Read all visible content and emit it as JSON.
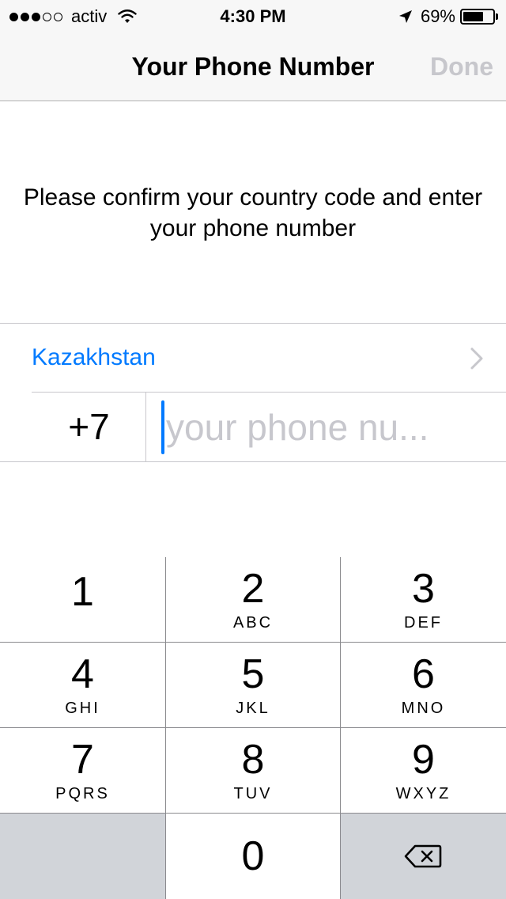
{
  "status_bar": {
    "carrier": "activ",
    "time": "4:30 PM",
    "battery_percent": "69%",
    "battery_level": 0.69,
    "signal_dots": [
      true,
      true,
      true,
      false,
      false
    ],
    "wifi_icon": "wifi-icon",
    "location_icon": "location-arrow-icon"
  },
  "nav": {
    "title": "Your Phone Number",
    "done_label": "Done"
  },
  "instruction": "Please confirm your country code and enter your phone number",
  "country": {
    "name": "Kazakhstan",
    "chevron_icon": "chevron-right-icon"
  },
  "phone": {
    "code": "+7",
    "placeholder": "your phone nu...",
    "value": ""
  },
  "keypad": {
    "keys": [
      {
        "num": "1",
        "letters": ""
      },
      {
        "num": "2",
        "letters": "ABC"
      },
      {
        "num": "3",
        "letters": "DEF"
      },
      {
        "num": "4",
        "letters": "GHI"
      },
      {
        "num": "5",
        "letters": "JKL"
      },
      {
        "num": "6",
        "letters": "MNO"
      },
      {
        "num": "7",
        "letters": "PQRS"
      },
      {
        "num": "8",
        "letters": "TUV"
      },
      {
        "num": "9",
        "letters": "WXYZ"
      },
      {
        "num": "0",
        "letters": ""
      }
    ],
    "delete_icon": "backspace-icon"
  },
  "colors": {
    "accent": "#007aff",
    "placeholder": "#c7c7cd",
    "disabled": "#c7c7cc",
    "keypad_dark": "#d1d4d9"
  }
}
